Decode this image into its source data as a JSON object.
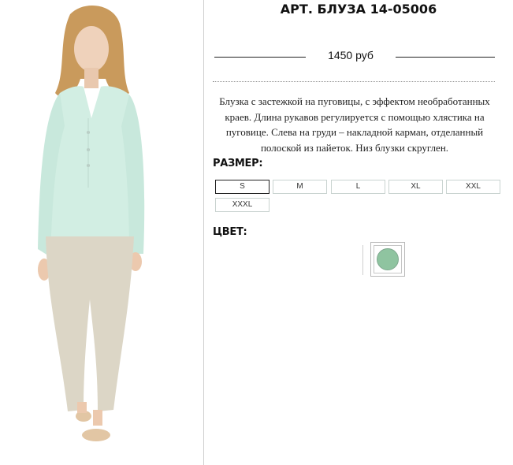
{
  "product": {
    "title_prefix": "АРТ.",
    "title_name": "БЛУЗА 14-05006",
    "price": "1450 руб",
    "description": "Блузка с застежкой на пуговицы, с эффектом необработанных краев. Длина рукавов регулируется с помощью хлястика на пуговице. Слева на груди – накладной карман, отделанный полоской из пайеток. Низ блузки скруглен."
  },
  "size_section": {
    "label": "РАЗМЕР:",
    "options": [
      "S",
      "M",
      "L",
      "XL",
      "XXL",
      "XXXL"
    ],
    "selected": "S"
  },
  "color_section": {
    "label": "ЦВЕТ:",
    "swatches": [
      {
        "color": "#8fc4a0",
        "selected": true
      }
    ]
  },
  "image": {
    "subject": "model-wearing-mint-blouse-and-beige-trousers"
  }
}
